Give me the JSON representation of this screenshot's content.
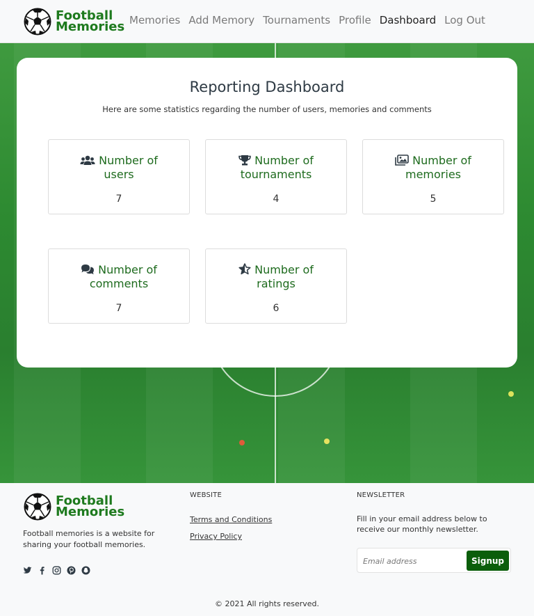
{
  "brand": {
    "line1": "Football",
    "line2": "Memories"
  },
  "nav": {
    "items": [
      {
        "label": "Memories",
        "active": false
      },
      {
        "label": "Add Memory",
        "active": false
      },
      {
        "label": "Tournaments",
        "active": false
      },
      {
        "label": "Profile",
        "active": false
      },
      {
        "label": "Dashboard",
        "active": true
      },
      {
        "label": "Log Out",
        "active": false
      }
    ]
  },
  "dashboard": {
    "title": "Reporting Dashboard",
    "subtitle": "Here are some statistics regarding the number of users, memories and comments",
    "stats": [
      {
        "line1": "Number of",
        "line2": "users",
        "value": "7",
        "icon": "users-icon"
      },
      {
        "line1": "Number of",
        "line2": "tournaments",
        "value": "4",
        "icon": "trophy-icon"
      },
      {
        "line1": "Number of",
        "line2": "memories",
        "value": "5",
        "icon": "images-icon"
      },
      {
        "line1": "Number of",
        "line2": "comments",
        "value": "7",
        "icon": "comments-icon"
      },
      {
        "line1": "Number of",
        "line2": "ratings",
        "value": "6",
        "icon": "star-half-icon"
      }
    ]
  },
  "footer": {
    "brand": {
      "line1": "Football",
      "line2": "Memories"
    },
    "description": "Football memories is a website for sharing your football memories.",
    "social_icons": [
      "twitter-icon",
      "facebook-icon",
      "instagram-icon",
      "pinterest-icon",
      "snapchat-icon"
    ],
    "website_heading": "WEBSITE",
    "links": [
      "Terms and Conditions",
      "Privacy Policy"
    ],
    "newsletter_heading": "NEWSLETTER",
    "newsletter_text": "Fill in your email address below to receive our monthly newsletter.",
    "email_placeholder": "Email address",
    "signup_label": "Signup",
    "copyright": "© 2021 All rights reserved."
  },
  "colors": {
    "brand_green": "#1e7a1e",
    "signup_button": "#0b5e0b",
    "stat_heading": "#1e6b1e"
  }
}
